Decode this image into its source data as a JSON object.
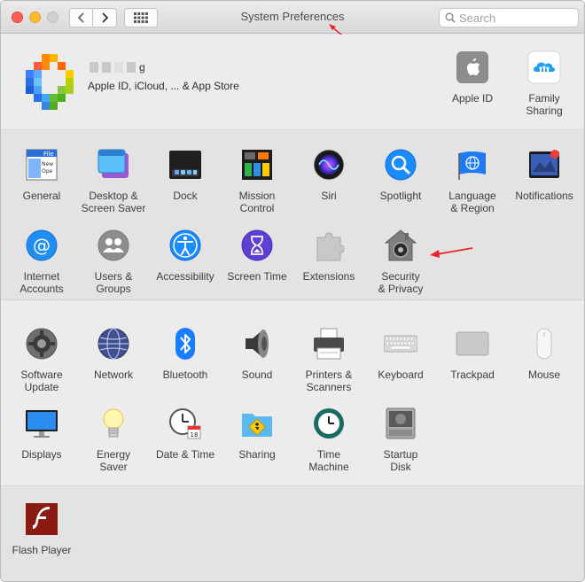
{
  "window": {
    "title": "System Preferences",
    "search_placeholder": "Search"
  },
  "account": {
    "name_fragment": "g",
    "subtitle": "Apple ID, iCloud, ... & App Store",
    "panes": [
      {
        "label": "Apple ID"
      },
      {
        "label": "Family\nSharing"
      }
    ]
  },
  "section1": {
    "row1": [
      {
        "label": "General"
      },
      {
        "label": "Desktop &\nScreen Saver"
      },
      {
        "label": "Dock"
      },
      {
        "label": "Mission\nControl"
      },
      {
        "label": "Siri"
      },
      {
        "label": "Spotlight"
      },
      {
        "label": "Language\n& Region"
      },
      {
        "label": "Notifications"
      }
    ],
    "row2": [
      {
        "label": "Internet\nAccounts"
      },
      {
        "label": "Users &\nGroups"
      },
      {
        "label": "Accessibility"
      },
      {
        "label": "Screen Time"
      },
      {
        "label": "Extensions"
      },
      {
        "label": "Security\n& Privacy"
      }
    ]
  },
  "section2": {
    "row1": [
      {
        "label": "Software\nUpdate"
      },
      {
        "label": "Network"
      },
      {
        "label": "Bluetooth"
      },
      {
        "label": "Sound"
      },
      {
        "label": "Printers &\nScanners"
      },
      {
        "label": "Keyboard"
      },
      {
        "label": "Trackpad"
      },
      {
        "label": "Mouse"
      }
    ],
    "row2": [
      {
        "label": "Displays"
      },
      {
        "label": "Energy\nSaver"
      },
      {
        "label": "Date & Time"
      },
      {
        "label": "Sharing"
      },
      {
        "label": "Time\nMachine"
      },
      {
        "label": "Startup\nDisk"
      }
    ]
  },
  "section3": {
    "panes": [
      {
        "label": "Flash Player"
      }
    ]
  },
  "colors": {
    "annotation_arrow": "#e8232a",
    "accent_blue": "#1a8cff"
  }
}
